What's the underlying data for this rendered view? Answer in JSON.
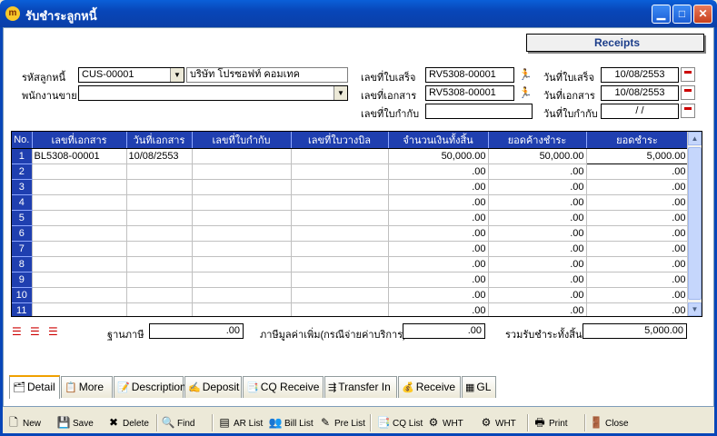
{
  "window": {
    "app_icon_glyph": "m",
    "title": "รับชำระลูกหนี้",
    "minimize": "▁",
    "maximize": "□",
    "close": "✕"
  },
  "header": {
    "section_label": "Receipts"
  },
  "form": {
    "customer_code_label": "รหัสลูกหนี้",
    "customer_code_value": "CUS-00001",
    "customer_name_value": "บริษัท โปรซอฟท์ คอมเทค",
    "salesperson_label": "พนักงานขาย",
    "salesperson_value": "",
    "receipt_no_label": "เลขที่ใบเสร็จ",
    "receipt_no_value": "RV5308-00001",
    "document_no_label": "เลขที่เอกสาร",
    "document_no_value": "RV5308-00001",
    "tax_invoice_no_label": "เลขที่ใบกำกับ",
    "tax_invoice_no_value": "",
    "receipt_date_label": "วันที่ใบเสร็จ",
    "receipt_date_value": "10/08/2553",
    "document_date_label": "วันที่เอกสาร",
    "document_date_value": "10/08/2553",
    "tax_invoice_date_label": "วันที่ใบกำกับ",
    "tax_invoice_date_value": " / /",
    "dropdown_glyph": "▼",
    "lookup_icon": "running-man-icon"
  },
  "grid": {
    "columns": [
      "No.",
      "เลขที่เอกสาร",
      "วันที่เอกสาร",
      "เลขที่ใบกำกับ",
      "เลขที่ใบวางบิล",
      "จำนวนเงินทั้งสิ้น",
      "ยอดค้างชำระ",
      "ยอดชำระ"
    ],
    "rows": [
      {
        "no": "1",
        "doc_no": "BL5308-00001",
        "doc_date": "10/08/2553",
        "tax_no": "",
        "bill_no": "",
        "total": "50,000.00",
        "outstanding": "50,000.00",
        "payment": "5,000.00"
      },
      {
        "no": "2",
        "doc_no": "",
        "doc_date": "",
        "tax_no": "",
        "bill_no": "",
        "total": ".00",
        "outstanding": ".00",
        "payment": ".00"
      },
      {
        "no": "3",
        "doc_no": "",
        "doc_date": "",
        "tax_no": "",
        "bill_no": "",
        "total": ".00",
        "outstanding": ".00",
        "payment": ".00"
      },
      {
        "no": "4",
        "doc_no": "",
        "doc_date": "",
        "tax_no": "",
        "bill_no": "",
        "total": ".00",
        "outstanding": ".00",
        "payment": ".00"
      },
      {
        "no": "5",
        "doc_no": "",
        "doc_date": "",
        "tax_no": "",
        "bill_no": "",
        "total": ".00",
        "outstanding": ".00",
        "payment": ".00"
      },
      {
        "no": "6",
        "doc_no": "",
        "doc_date": "",
        "tax_no": "",
        "bill_no": "",
        "total": ".00",
        "outstanding": ".00",
        "payment": ".00"
      },
      {
        "no": "7",
        "doc_no": "",
        "doc_date": "",
        "tax_no": "",
        "bill_no": "",
        "total": ".00",
        "outstanding": ".00",
        "payment": ".00"
      },
      {
        "no": "8",
        "doc_no": "",
        "doc_date": "",
        "tax_no": "",
        "bill_no": "",
        "total": ".00",
        "outstanding": ".00",
        "payment": ".00"
      },
      {
        "no": "9",
        "doc_no": "",
        "doc_date": "",
        "tax_no": "",
        "bill_no": "",
        "total": ".00",
        "outstanding": ".00",
        "payment": ".00"
      },
      {
        "no": "10",
        "doc_no": "",
        "doc_date": "",
        "tax_no": "",
        "bill_no": "",
        "total": ".00",
        "outstanding": ".00",
        "payment": ".00"
      },
      {
        "no": "11",
        "doc_no": "",
        "doc_date": "",
        "tax_no": "",
        "bill_no": "",
        "total": ".00",
        "outstanding": ".00",
        "payment": ".00"
      }
    ],
    "scroll_up": "▲",
    "scroll_down": "▼"
  },
  "totals": {
    "tax_base_label": "ฐานภาษี",
    "tax_base_value": ".00",
    "vat_label": "ภาษีมูลค่าเพิ่ม(กรณีจ่ายค่าบริการ)",
    "vat_value": ".00",
    "total_receipt_label": "รวมรับชำระทั้งสิ้น",
    "total_receipt_value": "5,000.00"
  },
  "tabs": [
    {
      "label": "Detail",
      "icon": "detail-icon",
      "glyph": "🗂"
    },
    {
      "label": "More",
      "icon": "more-icon",
      "glyph": "📋"
    },
    {
      "label": "Description",
      "icon": "description-icon",
      "glyph": "📝"
    },
    {
      "label": "Deposit",
      "icon": "deposit-icon",
      "glyph": "✍"
    },
    {
      "label": "CQ Receive",
      "icon": "cq-receive-icon",
      "glyph": "📑"
    },
    {
      "label": "Transfer In",
      "icon": "transfer-in-icon",
      "glyph": "⇶"
    },
    {
      "label": "Receive",
      "icon": "receive-icon",
      "glyph": "💰"
    },
    {
      "label": "GL",
      "icon": "gl-icon",
      "glyph": "▦"
    }
  ],
  "toolbar": [
    {
      "label": "New",
      "icon": "new-icon",
      "glyph": "🗋"
    },
    {
      "label": "Save",
      "icon": "save-icon",
      "glyph": "💾"
    },
    {
      "label": "Delete",
      "icon": "delete-icon",
      "glyph": "✖"
    },
    {
      "label": "Find",
      "icon": "find-icon",
      "glyph": "🔍"
    },
    {
      "label": "AR List",
      "icon": "ar-list-icon",
      "glyph": "▤"
    },
    {
      "label": "Bill List",
      "icon": "bill-list-icon",
      "glyph": "👥"
    },
    {
      "label": "Pre List",
      "icon": "pre-list-icon",
      "glyph": "✎"
    },
    {
      "label": "CQ List",
      "icon": "cq-list-icon",
      "glyph": "📑"
    },
    {
      "label": "WHT",
      "icon": "wht-icon",
      "glyph": "⚙"
    },
    {
      "label": "WHT",
      "icon": "wht-2-icon",
      "glyph": "⚙"
    },
    {
      "label": "Print",
      "icon": "print-icon",
      "glyph": "🖶"
    },
    {
      "label": "Close",
      "icon": "close-door-icon",
      "glyph": "🚪"
    }
  ],
  "colors": {
    "title_bar": "#0846b8",
    "grid_header": "#1f3fb0",
    "receipts_label_text": "#1b3d8a",
    "active_tab_top": "#f0a000"
  }
}
